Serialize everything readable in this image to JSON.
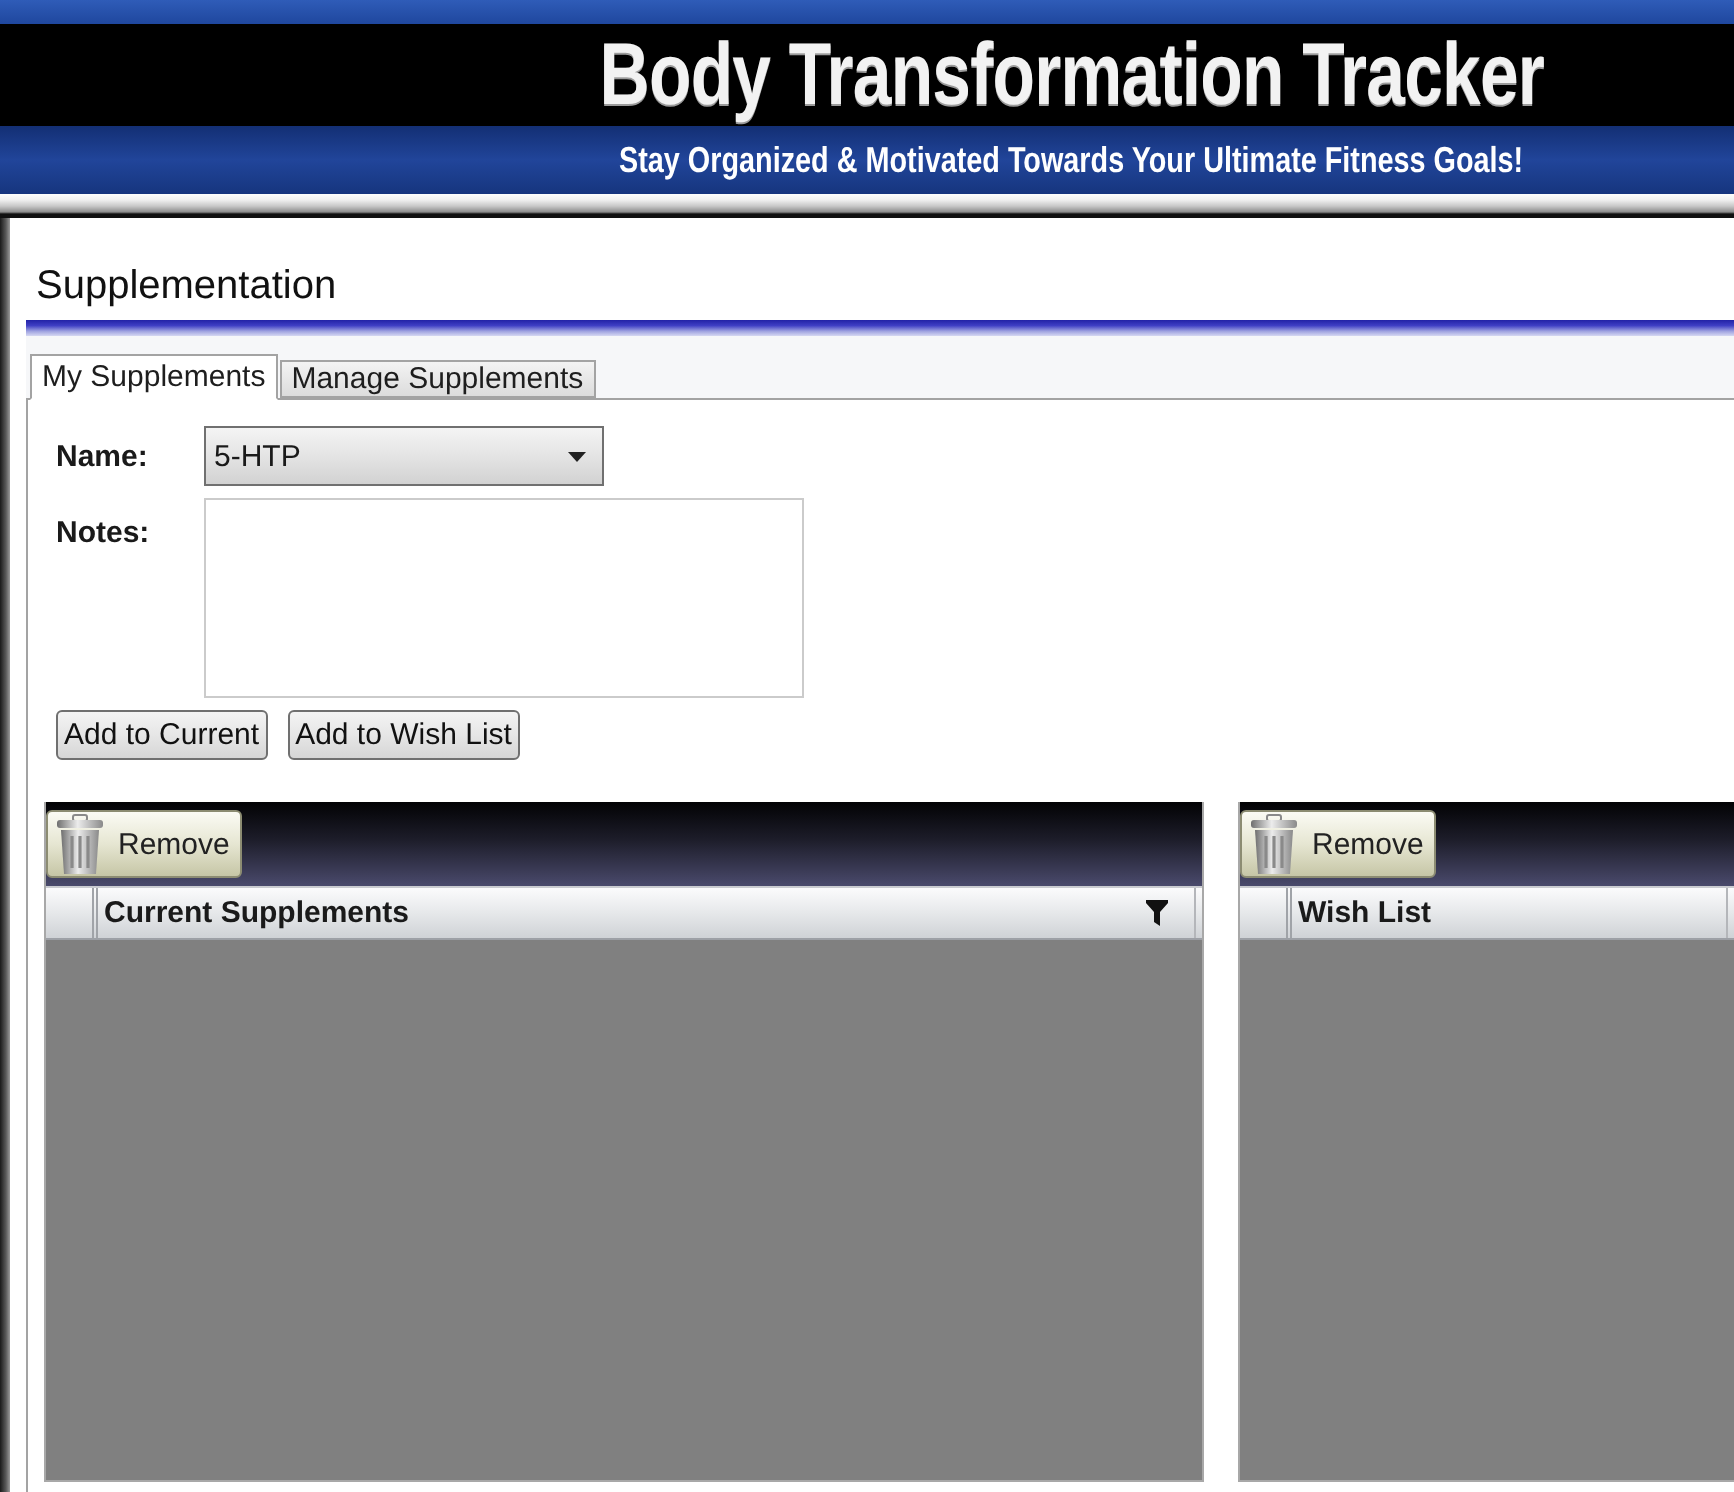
{
  "banner": {
    "title": "Body Transformation Tracker",
    "subtitle": "Stay Organized & Motivated Towards Your Ultimate Fitness Goals!"
  },
  "page": {
    "title": "Supplementation"
  },
  "tabs": [
    {
      "label": "My Supplements",
      "selected": true
    },
    {
      "label": "Manage Supplements",
      "selected": false
    }
  ],
  "form": {
    "name_label": "Name:",
    "name_value": "5-HTP",
    "notes_label": "Notes:",
    "buttons": [
      "Add to Current",
      "Add to Wish List"
    ]
  },
  "lists": [
    {
      "remove_button": "Remove",
      "column": "Current Supplements",
      "filterable": true
    },
    {
      "remove_button": "Remove",
      "column": "Wish List"
    }
  ]
}
